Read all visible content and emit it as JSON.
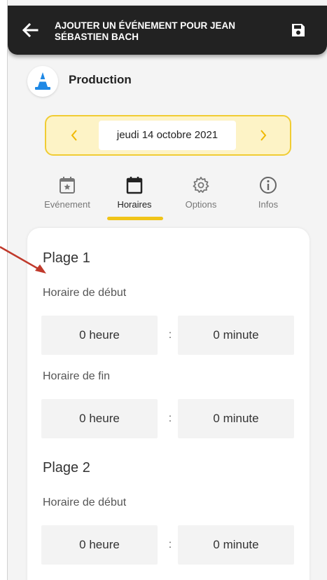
{
  "header": {
    "title": "AJOUTER UN ÉVÉNEMENT POUR JEAN SÉBASTIEN BACH",
    "back_icon": "arrow-left-icon",
    "save_icon": "save-icon"
  },
  "category": {
    "label": "Production",
    "icon": "traffic-cone-icon",
    "icon_color": "#1e88e5"
  },
  "date_picker": {
    "value": "jeudi 14 octobre 2021",
    "prev": "‹",
    "next": "›",
    "accent": "#f0c419"
  },
  "tabs": [
    {
      "label": "Evénement",
      "icon": "calendar-star-icon"
    },
    {
      "label": "Horaires",
      "icon": "calendar-icon",
      "active": true
    },
    {
      "label": "Options",
      "icon": "gear-icon"
    },
    {
      "label": "Infos",
      "icon": "info-icon"
    }
  ],
  "ranges": [
    {
      "title": "Plage 1",
      "start_label": "Horaire de début",
      "start_hour": "0 heure",
      "start_minute": "0 minute",
      "end_label": "Horaire de fin",
      "end_hour": "0 heure",
      "end_minute": "0 minute"
    },
    {
      "title": "Plage 2",
      "start_label": "Horaire de début",
      "start_hour": "0 heure",
      "start_minute": "0 minute"
    }
  ],
  "separator": ":",
  "annotation_color": "#c0392b"
}
